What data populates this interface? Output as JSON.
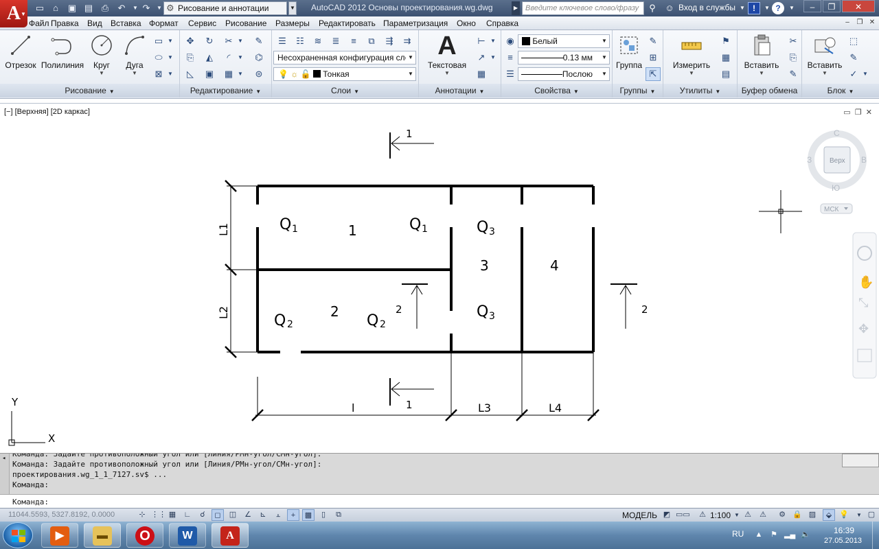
{
  "title_bar": {
    "workspace": "Рисование и аннотации",
    "window_title": "AutoCAD 2012    Основы проектирования.wg.dwg",
    "search_placeholder": "Введите ключевое слово/фразу",
    "login": "Вход в службы",
    "logo_letter": "A",
    "info_icon_text": "!",
    "help_icon_text": "?"
  },
  "menu": [
    "Файл",
    "Правка",
    "Вид",
    "Вставка",
    "Формат",
    "Сервис",
    "Рисование",
    "Размеры",
    "Редактировать",
    "Параметризация",
    "Окно",
    "Справка"
  ],
  "ribbon": {
    "draw": {
      "title": "Рисование",
      "line": "Отрезок",
      "polyline": "Полилиния",
      "circle": "Круг",
      "arc": "Дуга"
    },
    "modify": {
      "title": "Редактирование"
    },
    "layers": {
      "title": "Слои",
      "layer_state": "Несохраненная конфигурация сло",
      "current_layer": "Тонкая"
    },
    "annotation": {
      "title": "Аннотации",
      "text": "Текстовая"
    },
    "properties": {
      "title": "Свойства",
      "color": "Белый",
      "lineweight": "0.13 мм",
      "linetype": "Послою"
    },
    "groups": {
      "title": "Группы",
      "group": "Группа"
    },
    "utilities": {
      "title": "Утилиты",
      "measure": "Измерить"
    },
    "clipboard": {
      "title": "Буфер обмена",
      "paste": "Вставить"
    },
    "block": {
      "title": "Блок",
      "insert": "Вставить"
    }
  },
  "viewport": {
    "label": "[−] [Верхняя] [2D каркас]",
    "viewcube": {
      "top_face": "Верх",
      "north": "С",
      "south": "Ю",
      "east": "В",
      "west": "З",
      "ucs": "МСК"
    },
    "ucs_axes": {
      "x": "X",
      "y": "Y"
    }
  },
  "drawing": {
    "rooms": [
      "1",
      "2",
      "3",
      "4"
    ],
    "loads": {
      "q1a": "Q",
      "q1a_sub": "1",
      "q1b": "Q",
      "q1b_sub": "1",
      "q2a": "Q",
      "q2a_sub": "2",
      "q2b": "Q",
      "q2b_sub": "2",
      "q3a": "Q",
      "q3a_sub": "3",
      "q3b": "Q",
      "q3b_sub": "3"
    },
    "section_marks": {
      "top": "1",
      "bottom": "1",
      "mid": "2",
      "right": "2"
    },
    "dimensions": {
      "left_upper": "L1",
      "left_lower": "L2",
      "bottom_l": "l",
      "bottom_l3": "L3",
      "bottom_l4": "L4"
    }
  },
  "command": {
    "history": [
      "Команда: Задайте противоположный угол или [Линия/РМн-угол/СМн-угол]:",
      "Команда: Задайте противоположный угол или [Линия/РМн-угол/СМн-угол]:",
      "проектирования.wg_1_1_7127.sv$ ...",
      "Команда:"
    ],
    "prompt": "Команда:"
  },
  "status": {
    "coords": "11044.5593, 5327.8192, 0.0000",
    "model": "МОДЕЛЬ",
    "scale": "1:100"
  },
  "taskbar": {
    "language": "RU",
    "time": "16:39",
    "date": "27.05.2013",
    "apps": [
      "media-player",
      "file-explorer",
      "opera",
      "word",
      "autocad"
    ]
  },
  "colors": {
    "titlebar": "#4a5f7f",
    "ribbon": "#eef2f7",
    "command_bg": "#d9d9d9",
    "drawing_lines": "#000000",
    "taskbar": "#5f86ad"
  }
}
